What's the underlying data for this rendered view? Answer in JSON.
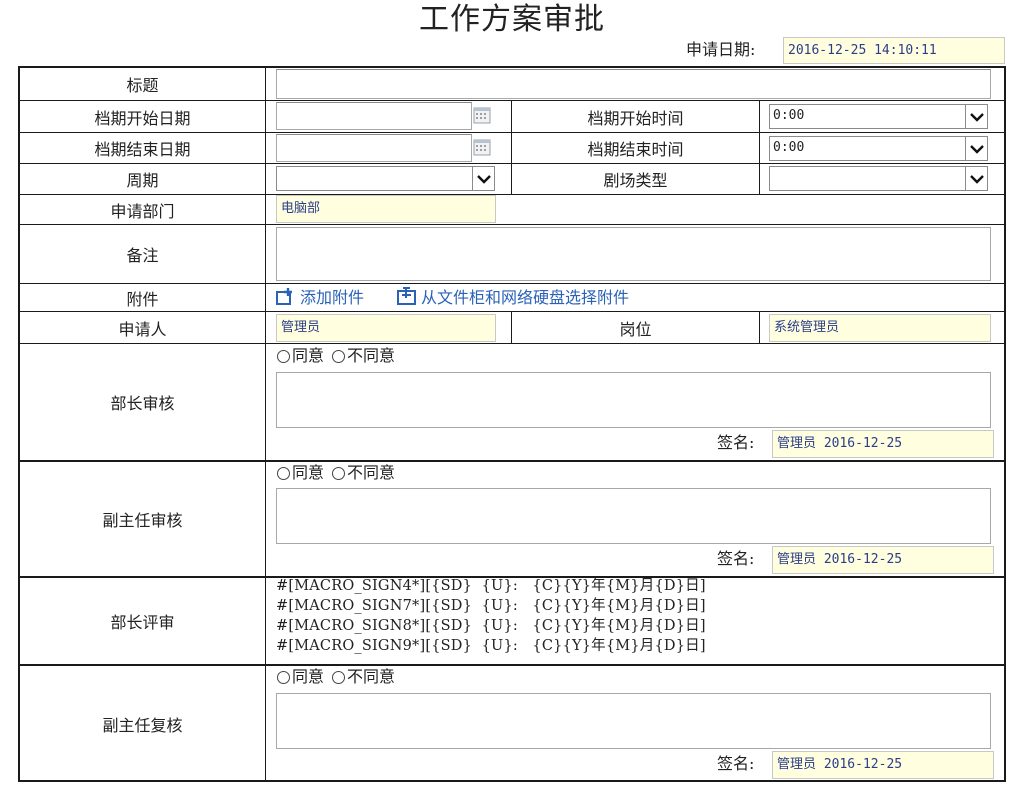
{
  "title": "工作方案审批",
  "apply_date": {
    "label": "申请日期:",
    "value": "2016-12-25 14:10:11"
  },
  "rows": {
    "title_label": "标题",
    "start_date_label": "档期开始日期",
    "start_time_label": "档期开始时间",
    "start_time_value": "0:00",
    "end_date_label": "档期结束日期",
    "end_time_label": "档期结束时间",
    "end_time_value": "0:00",
    "period_label": "周期",
    "period_value": "",
    "theater_label": "剧场类型",
    "theater_value": "",
    "dept_label": "申请部门",
    "dept_value": "电脑部",
    "remark_label": "备注",
    "attach_label": "附件",
    "attach_add": "添加附件",
    "attach_select": "从文件柜和网络硬盘选择附件",
    "applicant_label": "申请人",
    "applicant_value": "管理员",
    "position_label": "岗位",
    "position_value": "系统管理员"
  },
  "reviews": [
    {
      "label": "部长审核",
      "agree": "同意",
      "disagree": "不同意",
      "sign_label": "签名:",
      "sign_value": "管理员 2016-12-25"
    },
    {
      "label": "副主任审核",
      "agree": "同意",
      "disagree": "不同意",
      "sign_label": "签名:",
      "sign_value": "管理员 2016-12-25"
    },
    {
      "label": "部长评审",
      "macros": [
        "#[MACRO_SIGN4*][{SD}  {U}:   {C}{Y}年{M}月{D}日]",
        "#[MACRO_SIGN7*][{SD}  {U}:   {C}{Y}年{M}月{D}日]",
        "#[MACRO_SIGN8*][{SD}  {U}:   {C}{Y}年{M}月{D}日]",
        "#[MACRO_SIGN9*][{SD}  {U}:   {C}{Y}年{M}月{D}日]"
      ]
    },
    {
      "label": "副主任复核",
      "agree": "同意",
      "disagree": "不同意",
      "sign_label": "签名:",
      "sign_value": "管理员 2016-12-25"
    }
  ],
  "icons": [
    "calendar-icon",
    "chevron-down-icon",
    "attach-add-icon",
    "attach-folder-icon",
    "radio-icon"
  ],
  "colors": {
    "readonly_bg": "#ffffe0",
    "readonly_text": "#2b3d8a",
    "link": "#2a62b8",
    "border": "#1a1a1a"
  }
}
